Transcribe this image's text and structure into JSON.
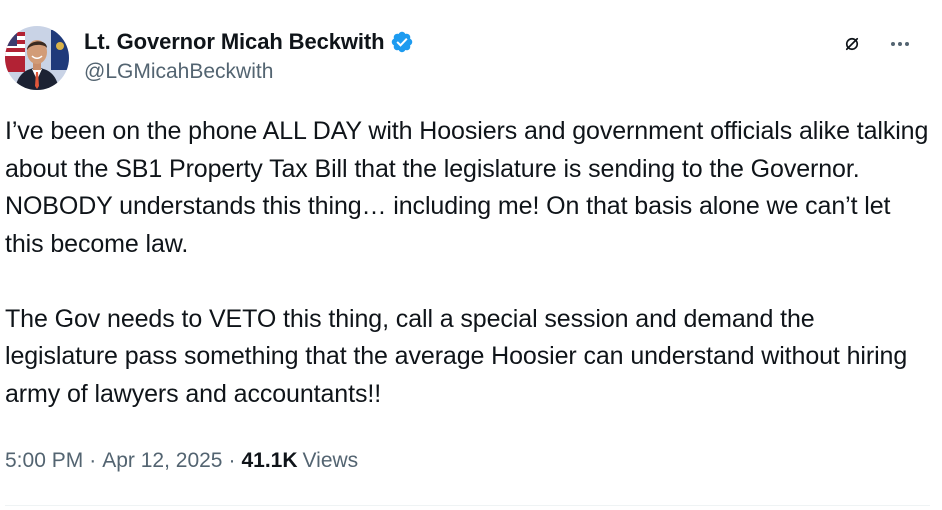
{
  "author": {
    "display_name": "Lt. Governor Micah Beckwith",
    "handle": "@LGMicahBeckwith",
    "verified": true,
    "verified_icon": "verified-badge-icon",
    "avatar_icon": "profile-photo"
  },
  "actions": {
    "grok_icon": "grok-icon",
    "more_icon": "more-options-icon"
  },
  "tweet": {
    "text": "I’ve been on the phone ALL DAY with Hoosiers and government officials alike talking about the SB1 Property Tax Bill that the legislature is sending to the Governor. NOBODY understands this thing… including me! On that basis alone we can’t let this become law.\n\nThe Gov needs to VETO this thing, call a special session and demand the legislature pass something that the average Hoosier can understand without hiring army of lawyers and accountants!!"
  },
  "meta": {
    "time": "5:00 PM",
    "separator": "·",
    "date": "Apr 12, 2025",
    "views_count": "41.1K",
    "views_label": "Views"
  },
  "colors": {
    "text_primary": "#0f1419",
    "text_secondary": "#536471",
    "verified_blue": "#1d9bf0"
  }
}
